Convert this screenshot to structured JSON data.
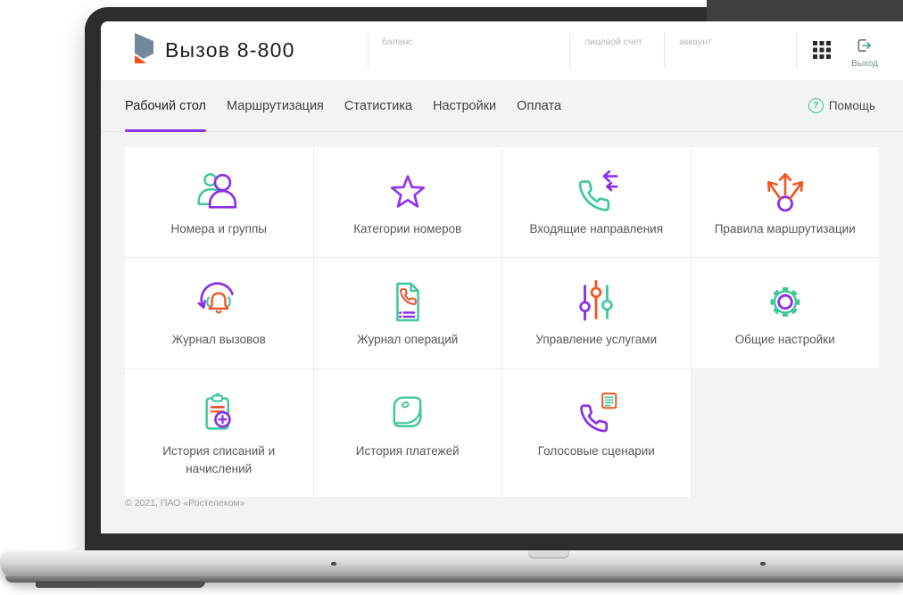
{
  "brand": {
    "title": "Вызов 8-800",
    "logo_icon": "rostelecom-logo"
  },
  "header": {
    "fields": [
      {
        "label": "баланс"
      },
      {
        "label": "лицевой счет"
      },
      {
        "label": "аккаунт"
      }
    ],
    "apps_icon": "apps-grid-icon",
    "logout": {
      "label": "Выход",
      "icon": "logout-icon"
    }
  },
  "nav": {
    "tabs": [
      {
        "label": "Рабочий стол",
        "active": true
      },
      {
        "label": "Маршрутизация",
        "active": false
      },
      {
        "label": "Статистика",
        "active": false
      },
      {
        "label": "Настройки",
        "active": false
      },
      {
        "label": "Оплата",
        "active": false
      }
    ],
    "help": {
      "label": "Помощь",
      "icon": "help-icon",
      "glyph": "?"
    }
  },
  "tiles": [
    {
      "label": "Номера и группы",
      "icon": "users-icon"
    },
    {
      "label": "Категории номеров",
      "icon": "star-icon"
    },
    {
      "label": "Входящие направления",
      "icon": "incoming-call-icon"
    },
    {
      "label": "Правила маршрутизации",
      "icon": "routing-arrows-icon"
    },
    {
      "label": "Журнал вызовов",
      "icon": "call-log-icon"
    },
    {
      "label": "Журнал операций",
      "icon": "operations-log-icon"
    },
    {
      "label": "Управление услугами",
      "icon": "sliders-icon"
    },
    {
      "label": "Общие настройки",
      "icon": "settings-gear-icon"
    },
    {
      "label": "История списаний и начислений",
      "icon": "charges-history-icon"
    },
    {
      "label": "История платежей",
      "icon": "payments-wallet-icon"
    },
    {
      "label": "Голосовые сценарии",
      "icon": "voice-scenarios-icon"
    }
  ],
  "footer": {
    "copyright": "© 2021, ПАО «Ростелеком»"
  },
  "colors": {
    "purple": "#8b2fe8",
    "green": "#3fc79e",
    "orange": "#f4551f",
    "red_orange": "#e84e27",
    "page_bg": "#f2f3f5",
    "dark_text": "#1d1d1f",
    "muted_text": "#9a9fa4"
  }
}
